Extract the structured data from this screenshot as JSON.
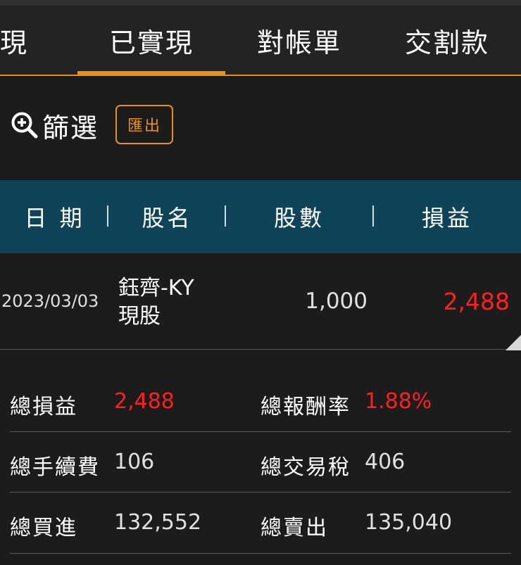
{
  "tabs": [
    {
      "label": "實現"
    },
    {
      "label": "已實現"
    },
    {
      "label": "對帳單"
    },
    {
      "label": "交割款"
    }
  ],
  "active_tab": 1,
  "toolbar": {
    "filter_label": "篩選",
    "export_label": "匯出"
  },
  "table": {
    "headers": [
      "日 期",
      "股名",
      "股數",
      "損益"
    ],
    "rows": [
      {
        "date": "2023/03/03",
        "name": "鈺齊-KY",
        "type": "現股",
        "shares": "1,000",
        "pnl": "2,488"
      }
    ]
  },
  "summary": {
    "total_pnl_label": "總損益",
    "total_pnl": "2,488",
    "total_return_label": "總報酬率",
    "total_return": "1.88%",
    "total_fee_label": "總手續費",
    "total_fee": "106",
    "total_tax_label": "總交易稅",
    "total_tax": "406",
    "total_buy_label": "總買進",
    "total_buy": "132,552",
    "total_sell_label": "總賣出",
    "total_sell": "135,040"
  },
  "colors": {
    "accent": "#e8901c",
    "header_bg": "#0f4458",
    "profit": "#ff1f1f",
    "background": "#1c1c1c"
  }
}
